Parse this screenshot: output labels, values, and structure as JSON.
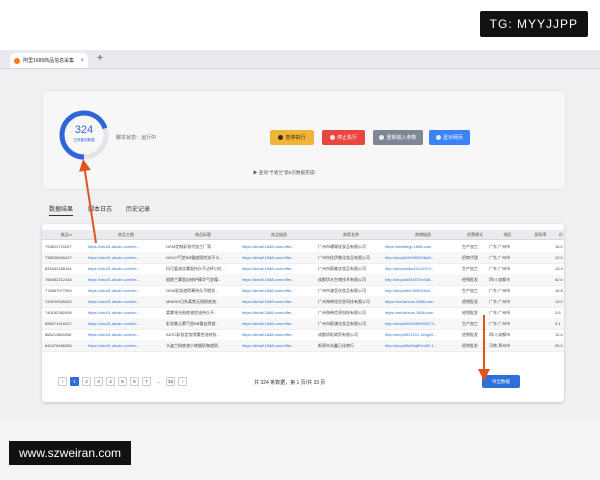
{
  "watermark_top": "TG: MYYJJPP",
  "watermark_bottom": "www.szweiran.com",
  "browser": {
    "tab_title": "阿里1688商品信息采集",
    "close": "×",
    "new_tab": "+"
  },
  "control": {
    "count": "324",
    "count_label": "已采集到数据",
    "progress": 0.7,
    "status": "脚本状态：运行中",
    "buttons": [
      {
        "label": "暂停执行"
      },
      {
        "label": "停止执行"
      },
      {
        "label": "重新输入参数"
      },
      {
        "label": "显示网页"
      }
    ],
    "hint": "▶ 查询\"卡姿兰\"第6页数据完成!"
  },
  "tabs": [
    "数据结果",
    "脚本日志",
    "历史记录"
  ],
  "table": {
    "headers": [
      "商品id",
      "商品主图",
      "商品标题",
      "商品链接",
      "商家名称",
      "商铺链接",
      "经营模式",
      "地区",
      "复购率",
      "价"
    ],
    "rows": [
      [
        "793811715227",
        "https://cbu01.alicdn.com/im...",
        "OEM定制彩妆代加工厂家...",
        "https://detail.1688.com/offer...",
        "广州市珊瑚化妆品有限公司",
        "https://marthhjp.1688.com",
        "生产加工",
        "广东 广州市",
        "",
        "15.0"
      ],
      [
        "738025840427",
        "https://cbu01.alicdn.com/im...",
        "NOVO气垫BB霜遮瑕控油不卡...",
        "https://detail.1688.com/offer...",
        "广州市佳伊美化妆品有限公司",
        "http://shop6164993048a2i...",
        "招商代理",
        "广东 广州市",
        "",
        "12.0"
      ],
      [
        "831542168161",
        "https://cbu01.alicdn.com/im...",
        "玛可爱迪丝雾面持久不沾杯口红...",
        "https://detail.1688.com/offer...",
        "广州市蔚美化妆品有限公司",
        "http://shopimibu45142974...",
        "生产加工",
        "广东 广州市",
        "",
        "13.4"
      ],
      [
        "766452212163",
        "https://cbu01.alicdn.com/im...",
        "韶颜兰雾面自修护精华气垫霜...",
        "https://detail.1688.com/offer...",
        "成都伊水生物技术有限公司",
        "http://shop4b551570v438...",
        "经销批发",
        "四川 成都市",
        "",
        "62.0"
      ],
      [
        "778457077264",
        "https://cbu01.alicdn.com/im...",
        "OEM彩妆遮瑕膏持久不脱妆...",
        "https://detail.1688.com/offer...",
        "广州市澳亚化妆品有限公司",
        "http://shopb840408349c0...",
        "生产加工",
        "广东 广州市",
        "",
        "15.5"
      ],
      [
        "749025349432",
        "https://cbu01.alicdn.com/im...",
        "MINISH日系柔焦无瑕粉底液...",
        "https://detail.1688.com/offer...",
        "广州海带花信息科技有限公司",
        "https://minishcos.1688.com",
        "经销批发",
        "广东 广州市",
        "",
        "13.0"
      ],
      [
        "740152382496",
        "https://cbu01.alicdn.com/im...",
        "柔雾哑光粉底液控油持久不...",
        "https://detail.1688.com/offer...",
        "广州海带信息科技有限公司",
        "https://minishcos.1688.com",
        "经销批发",
        "广东 广州市",
        "",
        "3.6"
      ],
      [
        "596071916207",
        "https://cbu01.alicdn.com/im...",
        "彩妆美元素气垫BB霜自然遮...",
        "https://detail.1688.com/offer...",
        "广州市蔚澳化妆品有限公司",
        "http://shopb99493f0892573...",
        "生产加工",
        "广东 广州市",
        "",
        "3.1"
      ],
      [
        "866211665255",
        "https://cbu01.alicdn.com/im...",
        "KATO彩妆定妆喷雾控油持妆...",
        "https://detail.1688.com/offer...",
        "成都妍彩商贸有限公司",
        "http://shop5522151 3chg52...",
        "经销批发",
        "四川 成都市",
        "",
        "12.0"
      ],
      [
        "842476496365",
        "https://cbu01.alicdn.com/im...",
        "卡姿兰粉底液小夜猫奶咖遮瑕...",
        "https://detail.1688.com/offer...",
        "新郑市永鑫日化商行",
        "http://shop85e65q89e430.1...",
        "经销批发",
        "河南 郑州市",
        "",
        "55.0"
      ]
    ]
  },
  "pagination": {
    "prev": "‹",
    "pages": [
      "1",
      "2",
      "3",
      "4",
      "5",
      "6",
      "7",
      "...",
      "33"
    ],
    "next": "›",
    "total": "共 324 条数据，第 1 页/共 33 页",
    "export": "导出数据"
  },
  "colors": {
    "primary": "#2f6fd8",
    "warning": "#f0b43a",
    "danger": "#e9463f",
    "gray": "#7e8794",
    "arrow": "#e2541f"
  }
}
